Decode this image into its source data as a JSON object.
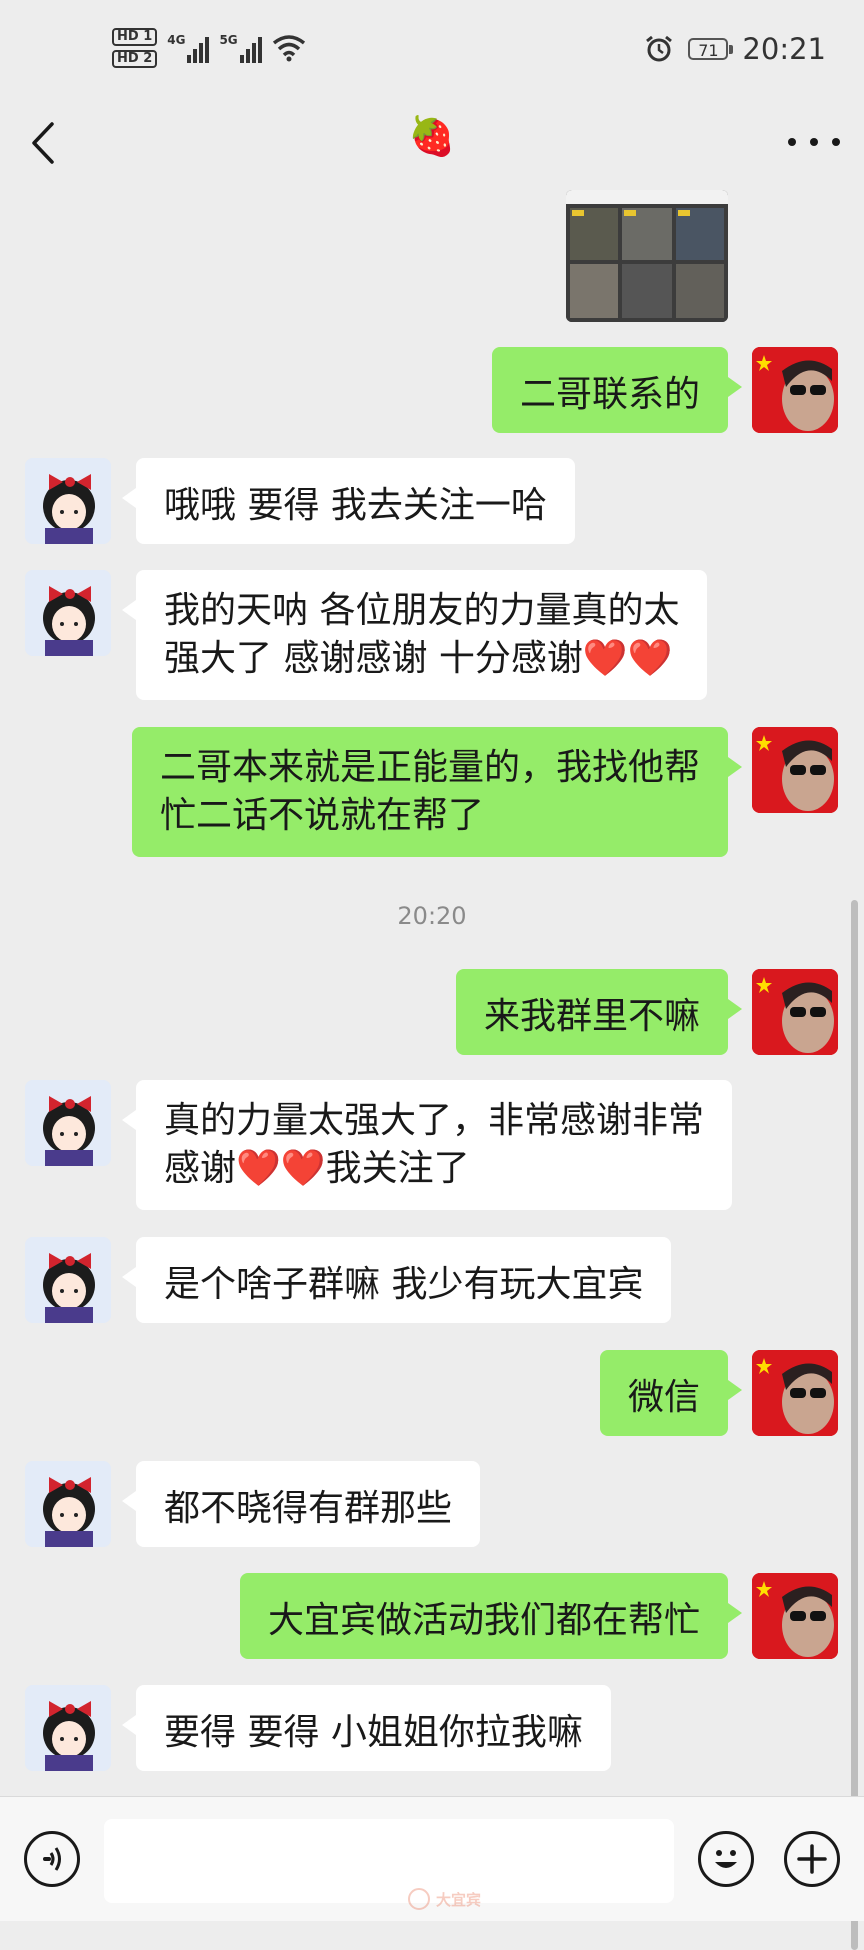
{
  "status_bar": {
    "hd1": "HD 1",
    "hd2": "HD 2",
    "net1": "4G",
    "net2": "5G",
    "battery": "71",
    "time": "20:21"
  },
  "header": {
    "title": "🍓"
  },
  "messages": [
    {
      "from": "me",
      "text": "二哥联系的"
    },
    {
      "from": "other",
      "text": "哦哦 要得 我去关注一哈"
    },
    {
      "from": "other",
      "line1": "我的天呐 各位朋友的力量真的太",
      "line2": "强大了 感谢感谢 十分感谢❤️❤️"
    },
    {
      "from": "me",
      "line1": "二哥本来就是正能量的，我找他帮",
      "line2": "忙二话不说就在帮了"
    },
    {
      "from": "me",
      "text": "来我群里不嘛"
    },
    {
      "from": "other",
      "line1": "真的力量太强大了，非常感谢非常",
      "line2": "感谢❤️❤️我关注了"
    },
    {
      "from": "other",
      "text": "是个啥子群嘛 我少有玩大宜宾"
    },
    {
      "from": "me",
      "text": "微信"
    },
    {
      "from": "other",
      "text": "都不晓得有群那些"
    },
    {
      "from": "me",
      "text": "大宜宾做活动我们都在帮忙"
    },
    {
      "from": "other",
      "text": "要得 要得 小姐姐你拉我嘛"
    }
  ],
  "timestamp": "20:20",
  "watermark": "大宜宾",
  "colors": {
    "sent_bubble": "#95ec69",
    "received_bubble": "#ffffff",
    "background": "#ededed"
  },
  "icons": {
    "back": "chevron-left-icon",
    "more": "more-icon",
    "voice": "voice-icon",
    "emoji": "emoji-icon",
    "plus": "plus-icon"
  }
}
